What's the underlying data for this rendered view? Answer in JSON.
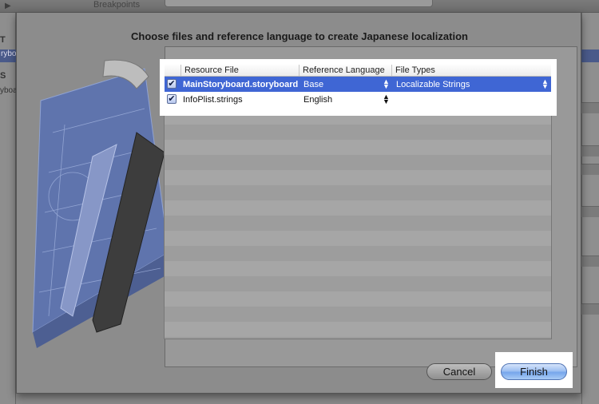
{
  "background_window": {
    "toolbar_label": "Breakpoints",
    "sidebar_fragments": [
      "T",
      "ryboar",
      "S",
      "yboar"
    ]
  },
  "sheet": {
    "title": "Choose files and reference language to create Japanese localization"
  },
  "table": {
    "columns": [
      "Resource File",
      "Reference Language",
      "File Types"
    ],
    "rows": [
      {
        "checked": true,
        "resource_file": "MainStoryboard.storyboard",
        "reference_language": "Base",
        "file_type": "Localizable Strings",
        "selected": true
      },
      {
        "checked": true,
        "resource_file": "InfoPlist.strings",
        "reference_language": "English",
        "file_type": "",
        "selected": false
      }
    ]
  },
  "buttons": {
    "cancel_label": "Cancel",
    "finish_label": "Finish"
  },
  "icons": {
    "check": "✔",
    "stepper_up": "▲",
    "stepper_down": "▼",
    "play": "▶"
  },
  "colors": {
    "selection": "#3f66d4",
    "default_button": "#76a6ec"
  }
}
